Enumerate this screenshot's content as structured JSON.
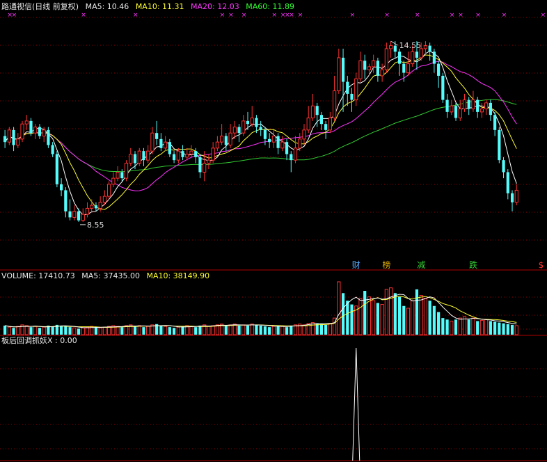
{
  "header": {
    "title": "路通视信(日线 前复权)",
    "ma5": "MA5: 10.46",
    "ma10": "MA10: 11.31",
    "ma20": "MA20: 12.03",
    "ma60": "MA60: 11.89"
  },
  "volume_header": {
    "label": "VOLUME: 17410.73",
    "ma5": "MA5: 37435.00",
    "ma10": "MA10: 38149.90"
  },
  "indicator_header": {
    "label": "板后回调抓妖X : 0.00"
  },
  "colors": {
    "up": "#ff3232",
    "down": "#54fcfc",
    "ma5": "#ffffff",
    "ma10": "#ffff33",
    "ma20": "#ff33ff",
    "ma60": "#33cc33",
    "grid": "#8b0000",
    "divider": "#b00000"
  },
  "chart_data": {
    "type": "candlestick",
    "price_axis": {
      "min": 7.0,
      "max": 15.5
    },
    "annotations": {
      "high": "14.55",
      "low": "8.55"
    },
    "event_labels": [
      {
        "text": "财",
        "color": "#54a8fc",
        "index": 81
      },
      {
        "text": "榜",
        "color": "#e8b400",
        "index": 88
      },
      {
        "text": "减",
        "color": "#33cc33",
        "index": 96
      },
      {
        "text": "跌",
        "color": "#33cc33",
        "index": 108
      },
      {
        "text": "$",
        "color": "#ff3232",
        "index": 124
      }
    ],
    "markers_x": [
      1,
      2,
      18,
      30,
      50,
      52,
      55,
      62,
      64,
      65,
      66,
      68,
      80,
      88,
      95,
      103,
      105,
      109,
      115,
      124
    ],
    "candles": [
      [
        11.4,
        11.2,
        11.6,
        11.0
      ],
      [
        11.2,
        11.6,
        11.7,
        11.1
      ],
      [
        11.6,
        11.1,
        11.7,
        10.9
      ],
      [
        11.1,
        11.3,
        11.5,
        11.0
      ],
      [
        11.3,
        11.8,
        11.9,
        11.2
      ],
      [
        11.8,
        11.9,
        12.1,
        11.6
      ],
      [
        11.9,
        11.5,
        12.0,
        11.4
      ],
      [
        11.5,
        11.7,
        11.8,
        11.3
      ],
      [
        11.7,
        11.4,
        11.8,
        11.3
      ],
      [
        11.4,
        11.6,
        11.7,
        11.2
      ],
      [
        11.6,
        11.1,
        11.7,
        11.0
      ],
      [
        11.1,
        10.8,
        11.2,
        10.7
      ],
      [
        10.8,
        9.8,
        10.9,
        9.7
      ],
      [
        9.8,
        9.6,
        10.0,
        9.4
      ],
      [
        9.6,
        8.9,
        9.7,
        8.7
      ],
      [
        8.9,
        8.7,
        9.3,
        8.6
      ],
      [
        8.7,
        8.9,
        9.1,
        8.6
      ],
      [
        8.9,
        8.6,
        9.0,
        8.55
      ],
      [
        8.6,
        8.8,
        9.0,
        8.55
      ],
      [
        8.8,
        9.0,
        9.2,
        8.7
      ],
      [
        9.0,
        9.1,
        9.3,
        8.9
      ],
      [
        9.1,
        9.0,
        9.2,
        8.9
      ],
      [
        9.0,
        9.2,
        9.4,
        8.9
      ],
      [
        9.2,
        9.4,
        9.6,
        9.1
      ],
      [
        9.4,
        9.8,
        9.9,
        9.3
      ],
      [
        9.8,
        10.0,
        10.2,
        9.7
      ],
      [
        10.0,
        10.2,
        10.4,
        9.9
      ],
      [
        10.2,
        10.0,
        10.3,
        9.9
      ],
      [
        10.0,
        10.5,
        10.6,
        9.9
      ],
      [
        10.5,
        10.8,
        11.0,
        10.4
      ],
      [
        10.8,
        10.5,
        10.9,
        10.3
      ],
      [
        10.5,
        10.9,
        11.0,
        10.4
      ],
      [
        10.9,
        10.6,
        11.0,
        10.4
      ],
      [
        10.6,
        10.9,
        11.1,
        10.5
      ],
      [
        10.9,
        11.5,
        11.7,
        10.8
      ],
      [
        11.5,
        11.3,
        11.9,
        11.1
      ],
      [
        11.3,
        11.0,
        11.5,
        10.9
      ],
      [
        11.0,
        11.2,
        11.4,
        10.9
      ],
      [
        11.2,
        10.8,
        11.3,
        10.7
      ],
      [
        10.8,
        10.6,
        10.9,
        10.5
      ],
      [
        10.6,
        10.9,
        11.0,
        10.5
      ],
      [
        10.9,
        10.7,
        11.1,
        10.6
      ],
      [
        10.7,
        10.8,
        11.0,
        10.6
      ],
      [
        10.8,
        10.9,
        11.1,
        10.7
      ],
      [
        10.9,
        10.7,
        11.0,
        10.5
      ],
      [
        10.7,
        10.2,
        10.8,
        10.0
      ],
      [
        10.2,
        10.5,
        10.9,
        9.9
      ],
      [
        10.5,
        10.6,
        10.8,
        10.3
      ],
      [
        10.6,
        11.0,
        11.2,
        10.5
      ],
      [
        11.0,
        11.2,
        11.4,
        10.9
      ],
      [
        11.2,
        11.4,
        11.8,
        11.1
      ],
      [
        11.4,
        11.1,
        11.5,
        10.9
      ],
      [
        11.1,
        11.5,
        11.8,
        11.0
      ],
      [
        11.5,
        11.7,
        11.9,
        11.3
      ],
      [
        11.7,
        11.5,
        11.8,
        11.2
      ],
      [
        11.5,
        11.9,
        12.1,
        11.4
      ],
      [
        11.9,
        11.8,
        12.2,
        11.6
      ],
      [
        11.8,
        12.0,
        12.4,
        11.7
      ],
      [
        12.0,
        11.7,
        12.1,
        11.5
      ],
      [
        11.7,
        11.6,
        11.9,
        11.4
      ],
      [
        11.6,
        11.3,
        11.7,
        11.1
      ],
      [
        11.3,
        11.2,
        11.5,
        11.0
      ],
      [
        11.2,
        11.4,
        11.6,
        11.0
      ],
      [
        11.4,
        11.0,
        11.5,
        10.8
      ],
      [
        11.0,
        11.2,
        11.4,
        10.9
      ],
      [
        11.2,
        10.8,
        11.3,
        10.6
      ],
      [
        10.8,
        10.6,
        10.9,
        10.2
      ],
      [
        10.6,
        11.0,
        11.4,
        10.5
      ],
      [
        11.0,
        11.3,
        11.5,
        10.9
      ],
      [
        11.3,
        11.6,
        11.8,
        11.1
      ],
      [
        11.6,
        12.0,
        12.4,
        11.5
      ],
      [
        12.0,
        12.4,
        12.8,
        11.9
      ],
      [
        12.4,
        12.1,
        12.5,
        11.7
      ],
      [
        12.1,
        11.8,
        12.2,
        11.6
      ],
      [
        11.8,
        11.6,
        11.9,
        11.3
      ],
      [
        11.6,
        12.0,
        12.2,
        11.5
      ],
      [
        12.0,
        12.9,
        13.4,
        11.9
      ],
      [
        12.9,
        14.0,
        14.3,
        12.8
      ],
      [
        14.0,
        13.2,
        14.3,
        12.2
      ],
      [
        13.2,
        12.8,
        13.4,
        12.4
      ],
      [
        12.8,
        12.6,
        13.0,
        12.2
      ],
      [
        12.6,
        13.3,
        13.5,
        12.4
      ],
      [
        13.3,
        13.9,
        14.2,
        13.2
      ],
      [
        13.9,
        13.6,
        14.1,
        13.3
      ],
      [
        13.6,
        13.7,
        13.8,
        13.4
      ],
      [
        13.7,
        13.9,
        14.1,
        13.5
      ],
      [
        13.9,
        13.4,
        14.0,
        13.2
      ],
      [
        13.4,
        13.6,
        13.8,
        13.2
      ],
      [
        13.6,
        14.3,
        14.5,
        13.5
      ],
      [
        14.3,
        14.4,
        14.55,
        14.0
      ],
      [
        14.4,
        14.2,
        14.55,
        14.0
      ],
      [
        14.2,
        13.8,
        14.3,
        13.4
      ],
      [
        13.8,
        13.5,
        13.9,
        13.2
      ],
      [
        13.5,
        13.8,
        14.2,
        13.4
      ],
      [
        13.8,
        14.2,
        14.4,
        13.7
      ],
      [
        14.2,
        14.0,
        14.55,
        13.6
      ],
      [
        14.0,
        14.3,
        14.5,
        13.9
      ],
      [
        14.3,
        14.4,
        14.55,
        14.1
      ],
      [
        14.4,
        14.2,
        14.5,
        13.9
      ],
      [
        14.2,
        13.8,
        14.3,
        13.5
      ],
      [
        13.8,
        13.4,
        13.9,
        13.0
      ],
      [
        13.4,
        12.6,
        13.5,
        12.5
      ],
      [
        12.6,
        12.2,
        12.8,
        12.0
      ],
      [
        12.2,
        12.4,
        12.6,
        12.1
      ],
      [
        12.4,
        12.0,
        12.5,
        11.9
      ],
      [
        12.0,
        12.3,
        12.6,
        11.9
      ],
      [
        12.3,
        12.6,
        12.8,
        12.2
      ],
      [
        12.6,
        12.3,
        12.7,
        12.1
      ],
      [
        12.3,
        12.6,
        12.9,
        12.2
      ],
      [
        12.6,
        12.2,
        12.7,
        12.0
      ],
      [
        12.2,
        12.3,
        12.5,
        12.0
      ],
      [
        12.3,
        12.5,
        12.6,
        12.1
      ],
      [
        12.5,
        12.1,
        12.6,
        11.9
      ],
      [
        12.1,
        11.6,
        12.2,
        11.4
      ],
      [
        11.6,
        10.6,
        11.7,
        10.5
      ],
      [
        10.6,
        10.2,
        10.7,
        10.0
      ],
      [
        10.2,
        9.5,
        10.3,
        9.3
      ],
      [
        9.5,
        9.2,
        9.6,
        8.9
      ],
      [
        9.2,
        9.6,
        9.8,
        9.1
      ]
    ],
    "volume": [
      12,
      10,
      9,
      11,
      13,
      12,
      10,
      11,
      9,
      10,
      12,
      11,
      13,
      12,
      11,
      10,
      9,
      8,
      9,
      10,
      11,
      10,
      9,
      10,
      11,
      12,
      11,
      10,
      12,
      13,
      11,
      12,
      10,
      11,
      13,
      14,
      12,
      11,
      10,
      9,
      10,
      11,
      12,
      11,
      10,
      12,
      13,
      11,
      12,
      13,
      14,
      12,
      13,
      14,
      12,
      13,
      12,
      14,
      13,
      12,
      11,
      10,
      11,
      12,
      11,
      10,
      12,
      13,
      14,
      13,
      15,
      16,
      15,
      14,
      13,
      15,
      22,
      70,
      55,
      45,
      40,
      38,
      48,
      58,
      50,
      45,
      42,
      40,
      60,
      62,
      55,
      50,
      38,
      35,
      45,
      60,
      52,
      48,
      45,
      38,
      30,
      22,
      20,
      18,
      20,
      22,
      24,
      20,
      22,
      18,
      19,
      20,
      18,
      17,
      16,
      15,
      14,
      13,
      12
    ],
    "indicator_spike": {
      "index": 81,
      "value": 1.0
    }
  }
}
